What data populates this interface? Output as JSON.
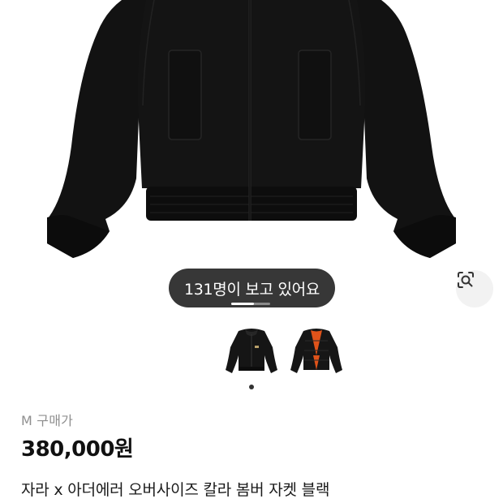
{
  "product": {
    "viewers_text": "131명이 보고 있어요",
    "size_label": "M 구매가",
    "price": "380,000원",
    "title": "자라 x 아더에러 오버사이즈 칼라 봄버 자켓 블랙"
  },
  "icons": {
    "lens": "visual-search-icon"
  },
  "colors": {
    "pill_background": "#262626",
    "jacket": "#111111",
    "lining_accent": "#e0531a",
    "muted_text": "#8f8f8f"
  }
}
